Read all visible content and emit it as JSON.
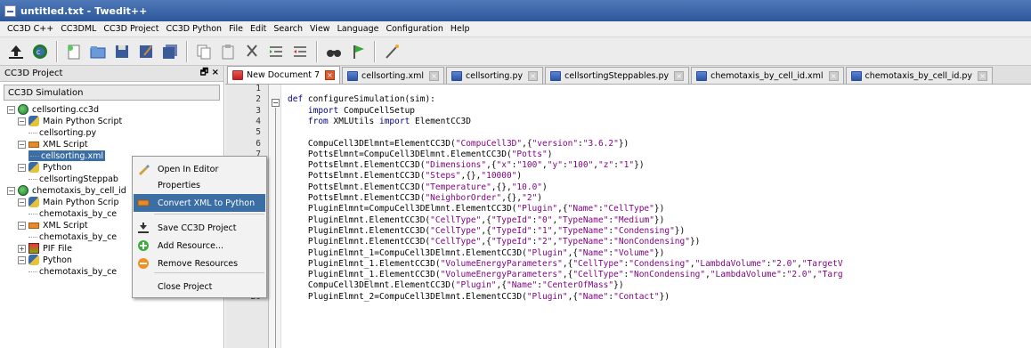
{
  "window": {
    "title": "untitled.txt - Twedit++"
  },
  "menu": [
    "CC3D C++",
    "CC3DML",
    "CC3D Project",
    "CC3D Python",
    "File",
    "Edit",
    "Search",
    "View",
    "Language",
    "Configuration",
    "Help"
  ],
  "toolbar_icons": [
    "upload-icon",
    "cc3d-logo-icon",
    "new-file-icon",
    "open-icon",
    "save-icon",
    "save-as-icon",
    "save-all-icon",
    "copy-icon",
    "paste-icon",
    "cut-icon",
    "indent-icon",
    "unindent-icon",
    "find-icon",
    "flag-icon",
    "wand-icon"
  ],
  "project_panel": {
    "title": "CC3D Project",
    "controls": "🗗 ×",
    "simulation_tab": "CC3D Simulation"
  },
  "tree": [
    {
      "label": "cellsorting.cc3d",
      "icon": "globe",
      "level": 0,
      "expander": "−"
    },
    {
      "label": "Main Python Script",
      "icon": "python",
      "level": 1,
      "expander": "−"
    },
    {
      "label": "cellsorting.py",
      "icon": "",
      "level": 2,
      "expander": ""
    },
    {
      "label": "XML Script",
      "icon": "xml",
      "level": 1,
      "expander": "−"
    },
    {
      "label": "cellsorting.xml",
      "icon": "",
      "level": 2,
      "expander": "",
      "selected": true
    },
    {
      "label": "Python",
      "icon": "python",
      "level": 1,
      "expander": "−"
    },
    {
      "label": "cellsortingSteppab",
      "icon": "",
      "level": 2,
      "expander": ""
    },
    {
      "label": "chemotaxis_by_cell_id",
      "icon": "globe",
      "level": 0,
      "expander": "−"
    },
    {
      "label": "Main Python Scrip",
      "icon": "python",
      "level": 1,
      "expander": "−"
    },
    {
      "label": "chemotaxis_by_ce",
      "icon": "",
      "level": 2,
      "expander": ""
    },
    {
      "label": "XML Script",
      "icon": "xml",
      "level": 1,
      "expander": "−"
    },
    {
      "label": "chemotaxis_by_ce",
      "icon": "",
      "level": 2,
      "expander": ""
    },
    {
      "label": "PIF File",
      "icon": "pif",
      "level": 1,
      "expander": "+"
    },
    {
      "label": "Python",
      "icon": "python",
      "level": 1,
      "expander": "−"
    },
    {
      "label": "chemotaxis_by_ce",
      "icon": "",
      "level": 2,
      "expander": ""
    }
  ],
  "context_menu": [
    {
      "label": "Open In Editor",
      "icon": "open-editor-icon"
    },
    {
      "label": "Properties",
      "icon": ""
    },
    {
      "label": "Convert XML to Python",
      "icon": "convert-icon",
      "highlighted": true
    },
    {
      "label": "Save CC3D Project",
      "icon": "save-project-icon"
    },
    {
      "label": "Add Resource...",
      "icon": "add-icon"
    },
    {
      "label": "Remove Resources",
      "icon": "remove-icon"
    },
    {
      "label": "Close Project",
      "icon": ""
    }
  ],
  "tabs": [
    {
      "label": "New Document 7",
      "active": true
    },
    {
      "label": "cellsorting.xml"
    },
    {
      "label": "cellsorting.py"
    },
    {
      "label": "cellsortingSteppables.py"
    },
    {
      "label": "chemotaxis_by_cell_id.xml"
    },
    {
      "label": "chemotaxis_by_cell_id.py"
    }
  ],
  "code_lines": [
    "",
    "def configureSimulation(sim):",
    "    import CompuCellSetup",
    "    from XMLUtils import ElementCC3D",
    "",
    "    CompuCell3DElmnt=ElementCC3D(\"CompuCell3D\",{\"version\":\"3.6.2\"})",
    "    PottsElmnt=CompuCell3DElmnt.ElementCC3D(\"Potts\")",
    "    PottsElmnt.ElementCC3D(\"Dimensions\",{\"x\":\"100\",\"y\":\"100\",\"z\":\"1\"})",
    "    PottsElmnt.ElementCC3D(\"Steps\",{},\"10000\")",
    "    PottsElmnt.ElementCC3D(\"Temperature\",{},\"10.0\")",
    "    PottsElmnt.ElementCC3D(\"NeighborOrder\",{},\"2\")",
    "    PluginElmnt=CompuCell3DElmnt.ElementCC3D(\"Plugin\",{\"Name\":\"CellType\"})",
    "    PluginElmnt.ElementCC3D(\"CellType\",{\"TypeId\":\"0\",\"TypeName\":\"Medium\"})",
    "    PluginElmnt.ElementCC3D(\"CellType\",{\"TypeId\":\"1\",\"TypeName\":\"Condensing\"})",
    "    PluginElmnt.ElementCC3D(\"CellType\",{\"TypeId\":\"2\",\"TypeName\":\"NonCondensing\"})",
    "    PluginElmnt_1=CompuCell3DElmnt.ElementCC3D(\"Plugin\",{\"Name\":\"Volume\"})",
    "    PluginElmnt_1.ElementCC3D(\"VolumeEnergyParameters\",{\"CellType\":\"Condensing\",\"LambdaVolume\":\"2.0\",\"TargetV",
    "    PluginElmnt_1.ElementCC3D(\"VolumeEnergyParameters\",{\"CellType\":\"NonCondensing\",\"LambdaVolume\":\"2.0\",\"Targ",
    "    CompuCell3DElmnt.ElementCC3D(\"Plugin\",{\"Name\":\"CenterOfMass\"})",
    "    PluginElmnt_2=CompuCell3DElmnt.ElementCC3D(\"Plugin\",{\"Name\":\"Contact\"})"
  ]
}
